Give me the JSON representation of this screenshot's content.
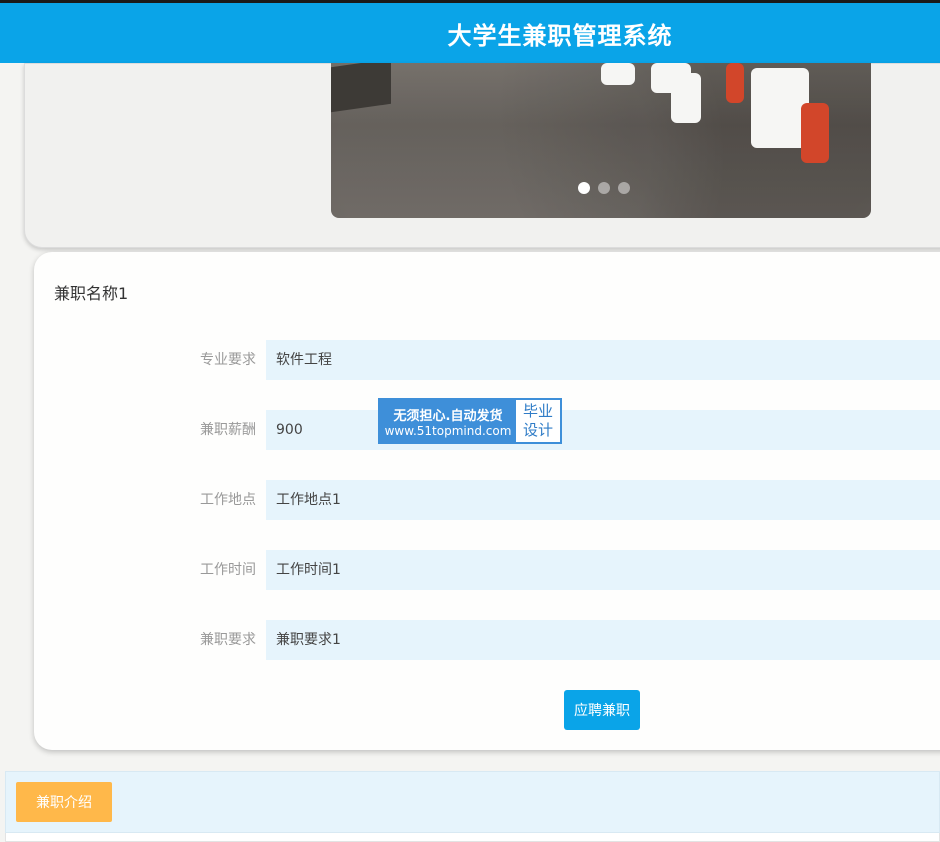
{
  "header": {
    "title": "大学生兼职管理系统"
  },
  "carousel": {
    "slide_count": 3,
    "active_index": 0
  },
  "job": {
    "name": "兼职名称1",
    "fields": [
      {
        "label": "专业要求",
        "value": "软件工程"
      },
      {
        "label": "兼职薪酬",
        "value": "900"
      },
      {
        "label": "工作地点",
        "value": "工作地点1"
      },
      {
        "label": "工作时间",
        "value": "工作时间1"
      },
      {
        "label": "兼职要求",
        "value": "兼职要求1"
      }
    ],
    "apply_label": "应聘兼职"
  },
  "watermark": {
    "line1": "无须担心.自动发货",
    "line2": "www.51topmind.com",
    "side1": "毕业",
    "side2": "设计"
  },
  "intro": {
    "tab_label": "兼职介绍"
  },
  "colors": {
    "primary": "#0aa4e8",
    "accent": "#ffb84a",
    "field_bg": "#e6f4fc"
  }
}
